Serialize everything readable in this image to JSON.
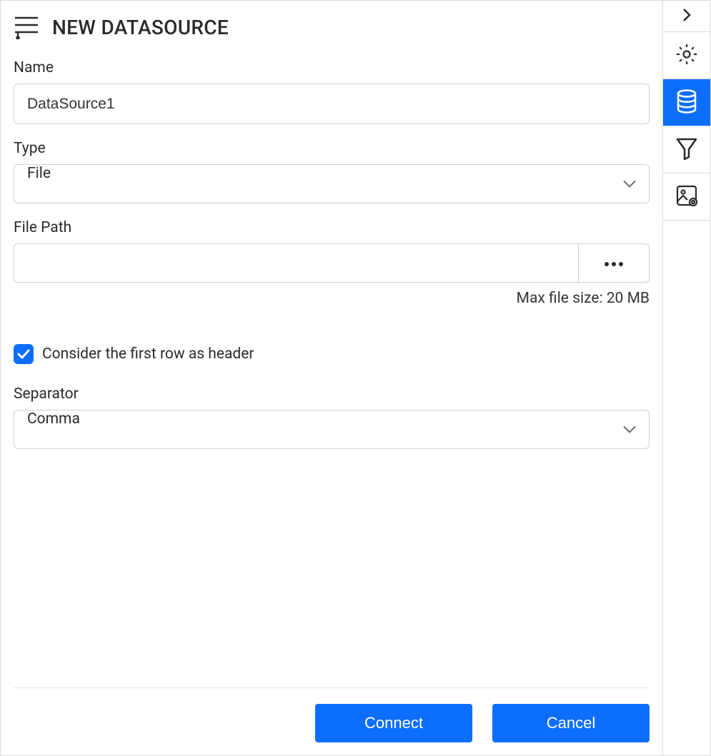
{
  "header": {
    "title": "NEW DATASOURCE"
  },
  "form": {
    "name_label": "Name",
    "name_value": "DataSource1",
    "type_label": "Type",
    "type_value": "File",
    "filepath_label": "File Path",
    "filepath_value": "",
    "max_filesize": "Max file size: 20 MB",
    "firstrow_label": "Consider the first row as header",
    "firstrow_checked": true,
    "separator_label": "Separator",
    "separator_value": "Comma"
  },
  "footer": {
    "connect": "Connect",
    "cancel": "Cancel"
  },
  "sidebar": {
    "collapse": "chevron-right",
    "settings": "gear",
    "datasource": "database",
    "filter": "funnel",
    "image": "image-settings"
  }
}
